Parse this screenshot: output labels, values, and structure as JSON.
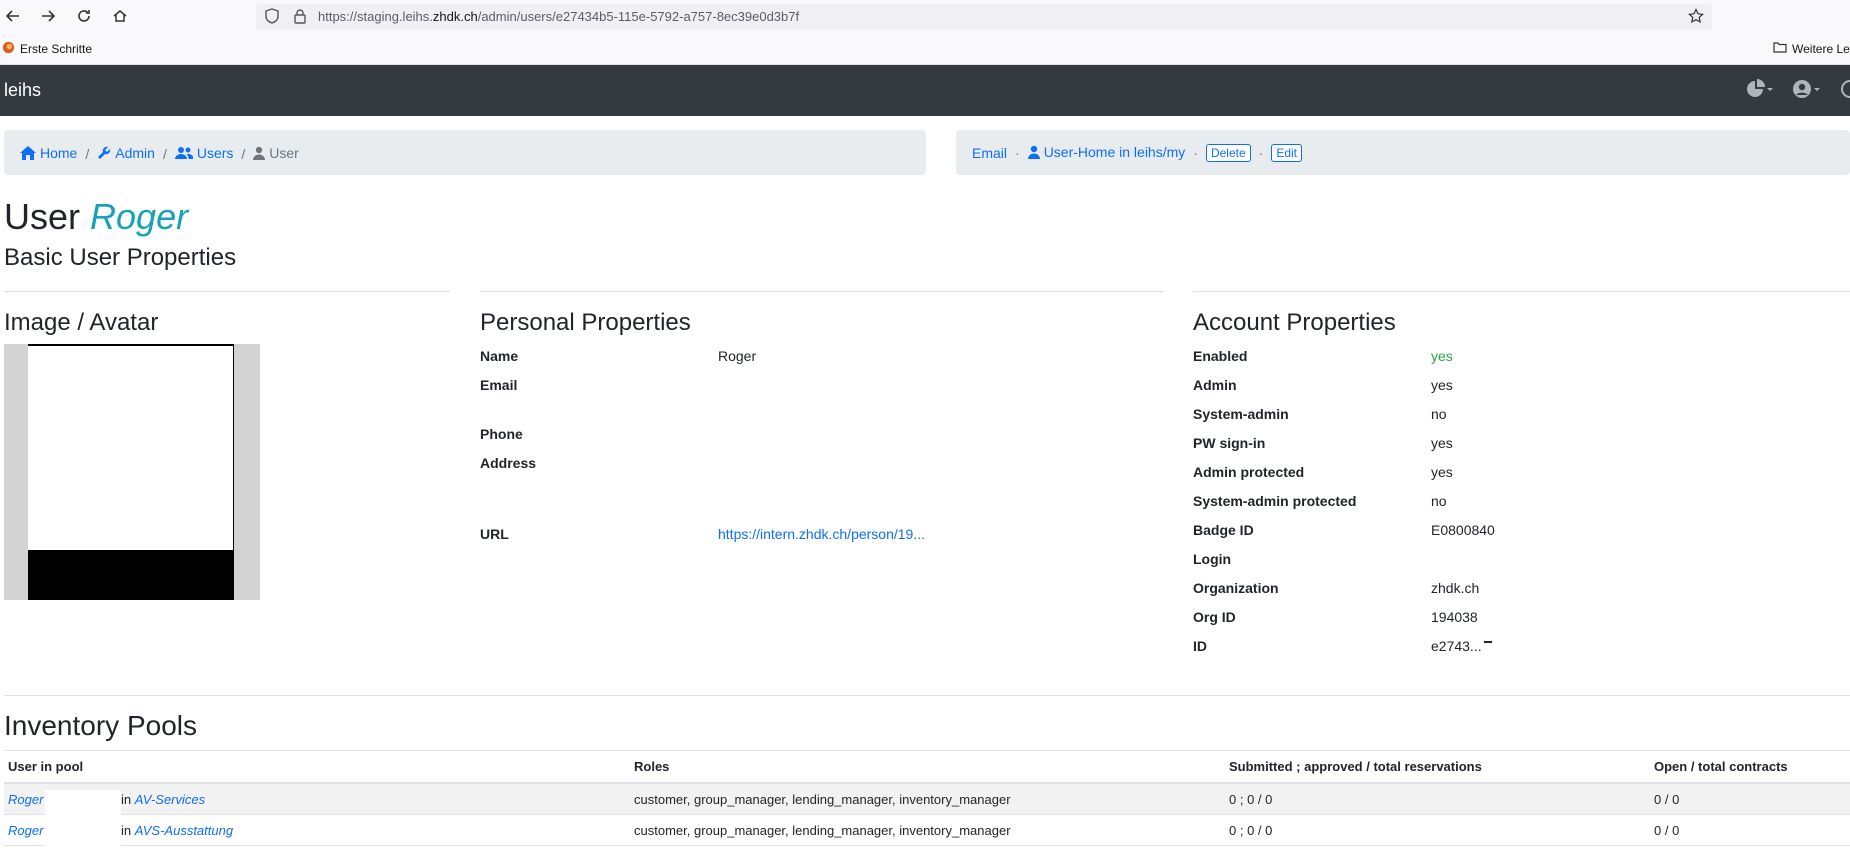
{
  "browser": {
    "url_prefix": "https://staging.leihs.",
    "url_domain": "zhdk.ch",
    "url_suffix": "/admin/users/e27434b5-115e-5792-a757-8ec39e0d3b7f",
    "bookmark_left": "Erste Schritte",
    "bookmark_right": "Weitere Les"
  },
  "navbar": {
    "brand": "leihs"
  },
  "breadcrumbs": {
    "home": "Home",
    "admin": "Admin",
    "users": "Users",
    "current": "User",
    "sep": "/"
  },
  "actions": {
    "email": "Email",
    "dot": "·",
    "user_home": "User-Home in leihs/my",
    "delete": "Delete",
    "edit": "Edit"
  },
  "heading": {
    "prefix": "User",
    "name": "Roger",
    "subtitle": "Basic User Properties"
  },
  "image_section": {
    "title": "Image / Avatar"
  },
  "personal": {
    "title": "Personal Properties",
    "name_label": "Name",
    "name_value": "Roger",
    "email_label": "Email",
    "phone_label": "Phone",
    "address_label": "Address",
    "url_label": "URL",
    "url_value": "https://intern.zhdk.ch/person/19..."
  },
  "account": {
    "title": "Account Properties",
    "rows": [
      {
        "label": "Enabled",
        "value": "yes"
      },
      {
        "label": "Admin",
        "value": "yes"
      },
      {
        "label": "System-admin",
        "value": "no"
      },
      {
        "label": "PW sign-in",
        "value": "yes"
      },
      {
        "label": "Admin protected",
        "value": "yes"
      },
      {
        "label": "System-admin protected",
        "value": "no"
      },
      {
        "label": "Badge ID",
        "value": "E0800840"
      },
      {
        "label": "Login",
        "value": ""
      },
      {
        "label": "Organization",
        "value": "zhdk.ch"
      },
      {
        "label": "Org ID",
        "value": "194038"
      },
      {
        "label": "ID",
        "value": "e2743..."
      }
    ],
    "enabled_color": "#28a745"
  },
  "inventory": {
    "title": "Inventory Pools",
    "headers": [
      "User in pool",
      "Roles",
      "Submitted ; approved / total reservations",
      "Open / total contracts"
    ],
    "rows": [
      {
        "user": "Roger",
        "in": "in",
        "pool": "AV-Services",
        "roles": "customer, group_manager, lending_manager, inventory_manager",
        "reservations": "0 ; 0 / 0",
        "contracts": "0 / 0"
      },
      {
        "user": "Roger",
        "in": "in",
        "pool": "AVS-Ausstattung",
        "roles": "customer, group_manager, lending_manager, inventory_manager",
        "reservations": "0 ; 0 / 0",
        "contracts": "0 / 0"
      }
    ]
  }
}
